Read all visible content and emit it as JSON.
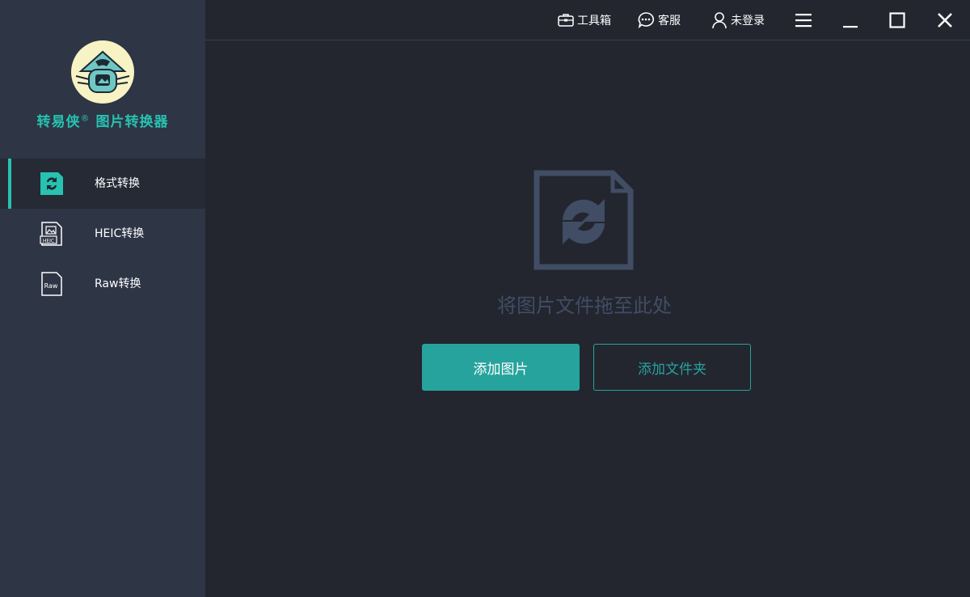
{
  "app": {
    "name": "转易侠",
    "registered_mark": "®",
    "subtitle": "图片转换器"
  },
  "sidebar": {
    "items": [
      {
        "label": "格式转换",
        "icon": "format-convert-icon",
        "active": true
      },
      {
        "label": "HEIC转换",
        "icon": "heic-file-icon",
        "active": false
      },
      {
        "label": "Raw转换",
        "icon": "raw-file-icon",
        "active": false
      }
    ]
  },
  "topbar": {
    "toolbox_label": "工具箱",
    "support_label": "客服",
    "login_label": "未登录"
  },
  "main": {
    "drop_hint": "将图片文件拖至此处",
    "add_image_label": "添加图片",
    "add_folder_label": "添加文件夹"
  },
  "colors": {
    "accent": "#27c2b0",
    "button": "#27a39d",
    "sidebar_bg": "#2e3545",
    "main_bg": "#23262f",
    "drop_icon": "#404d64"
  }
}
